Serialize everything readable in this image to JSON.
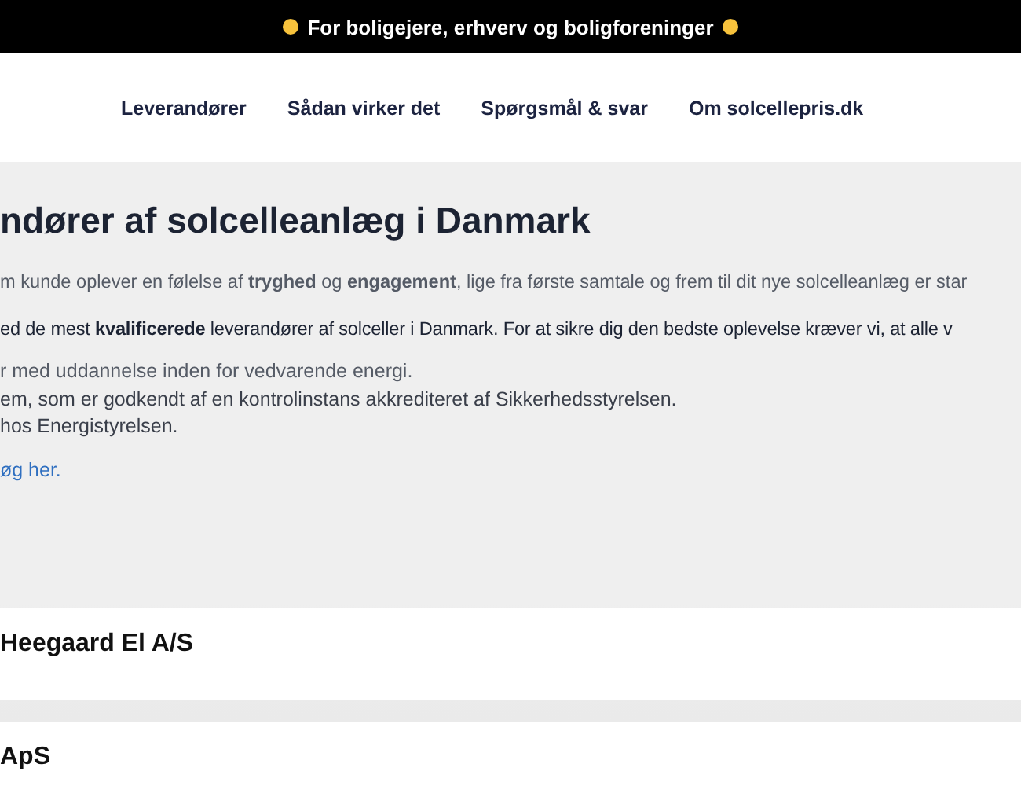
{
  "top_banner": {
    "text": "For boligejere, erhverv og boligforeninger"
  },
  "nav": {
    "items": [
      {
        "label": "Leverandører"
      },
      {
        "label": "Sådan virker det"
      },
      {
        "label": "Spørgsmål & svar"
      },
      {
        "label": "Om **solcellepris.**dk"
      }
    ]
  },
  "hero": {
    "heading": "ndører af solcelleanlæg i Danmark",
    "intro": "m kunde oplever en følelse af  **tryghed** og **engagement**, lige fra første samtale og frem til dit nye solcelleanlæg er star",
    "statement": "ed de mest **kvalificerede** leverandører af solceller i Danmark. For at sikre dig den bedste oplevelse kræver vi, at alle v",
    "requirements": [
      "r med uddannelse inden for vedvarende energi.",
      "em, som er godkendt af en kontrolinstans akkrediteret af Sikkerhedsstyrelsen.",
      "hos Energistyrelsen."
    ],
    "link": "øg her."
  },
  "suppliers": [
    {
      "name": "Heegaard El A/S"
    },
    {
      "name": "ApS"
    }
  ]
}
